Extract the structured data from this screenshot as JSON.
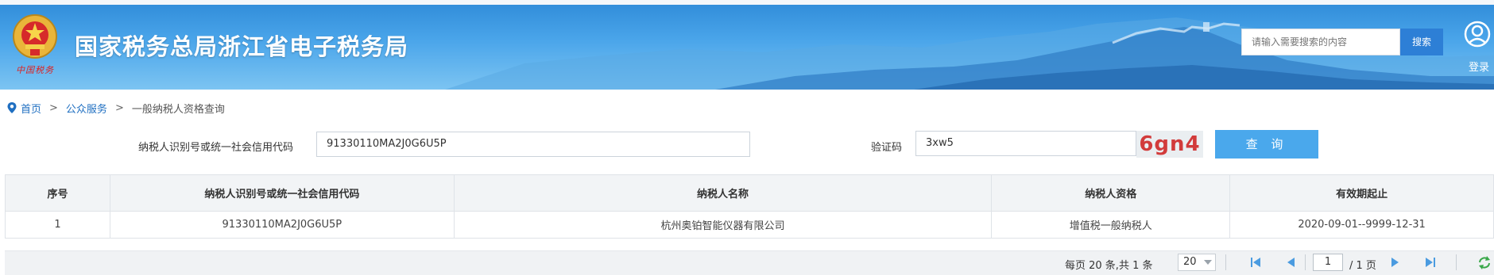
{
  "header": {
    "title": "国家税务总局浙江省电子税务局",
    "emblem_text": "中国税务",
    "search_placeholder": "请输入需要搜索的内容",
    "search_button": "搜索",
    "login_label": "登录"
  },
  "breadcrumb": {
    "home": "首页",
    "sep1": ">",
    "section": "公众服务",
    "sep2": ">",
    "current": "一般纳税人资格查询"
  },
  "form": {
    "taxid_label": "纳税人识别号或统一社会信用代码",
    "taxid_value": "91330110MA2J0G6U5P",
    "captcha_label": "验证码",
    "captcha_input": "3xw5",
    "captcha_image_text": "6gn4",
    "query_button": "查 询"
  },
  "table": {
    "headers": [
      "序号",
      "纳税人识别号或统一社会信用代码",
      "纳税人名称",
      "纳税人资格",
      "有效期起止"
    ],
    "rows": [
      [
        "1",
        "91330110MA2J0G6U5P",
        "杭州奥铂智能仪器有限公司",
        "增值税一般纳税人",
        "2020-09-01--9999-12-31"
      ]
    ]
  },
  "pager": {
    "summary": "每页 20 条,共 1 条",
    "page_size": "20",
    "current_page": "1",
    "total_pages": "/ 1 页"
  },
  "colors": {
    "banner": "#3d9ae4",
    "link": "#1f6fc1",
    "query_button": "#4aa8ec",
    "search_button": "#2d7fd6",
    "captcha_text": "#d23b3b"
  }
}
